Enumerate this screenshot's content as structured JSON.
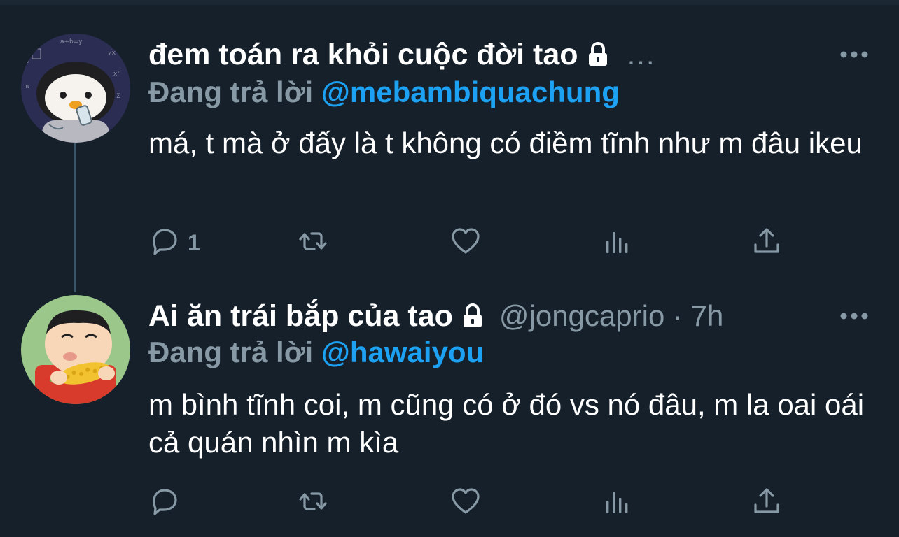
{
  "colors": {
    "background": "#15202b",
    "primary_text": "#ffffff",
    "muted_text": "#8899a6",
    "link": "#1da1f2",
    "thread_line": "#3d5466"
  },
  "tweets": [
    {
      "display_name": "đem toán ra khỏi cuộc đời tao",
      "locked": true,
      "handle_meta": "...",
      "reply_prefix": "Đang trả lời",
      "reply_handle": "@mebambiquachung",
      "body": "má, t mà ở đấy là t không có điềm tĩnh như m đâu ikeu",
      "reply_count": "1",
      "avatar": "penguin-avatar"
    },
    {
      "display_name": "Ai ăn trái bắp của tao",
      "locked": true,
      "handle_meta": "@jongcaprio · 7h",
      "reply_prefix": "Đang trả lời",
      "reply_handle": "@hawaiyou",
      "body": "m bình tĩnh coi, m cũng có ở đó vs nó đâu, m la oai oái cả quán nhìn m kìa",
      "reply_count": "",
      "avatar": "cartoon-boy-corn-avatar"
    }
  ],
  "icons": {
    "lock": "lock-icon",
    "more": "more-icon",
    "reply": "reply-icon",
    "retweet": "retweet-icon",
    "like": "heart-icon",
    "analytics": "analytics-icon",
    "share": "share-icon"
  }
}
